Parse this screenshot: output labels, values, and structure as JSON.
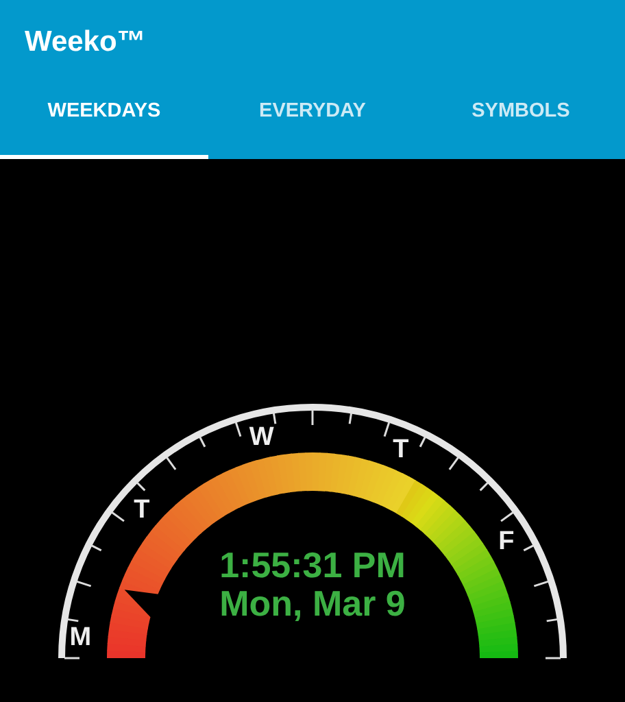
{
  "app": {
    "title": "Weeko™"
  },
  "tabs": [
    {
      "label": "WEEKDAYS",
      "selected": true
    },
    {
      "label": "EVERYDAY",
      "selected": false
    },
    {
      "label": "SYMBOLS",
      "selected": false
    }
  ],
  "gauge": {
    "day_labels": [
      "M",
      "T",
      "W",
      "T",
      "F"
    ],
    "time": "1:55:31 PM",
    "date": "Mon, Mar 9"
  }
}
